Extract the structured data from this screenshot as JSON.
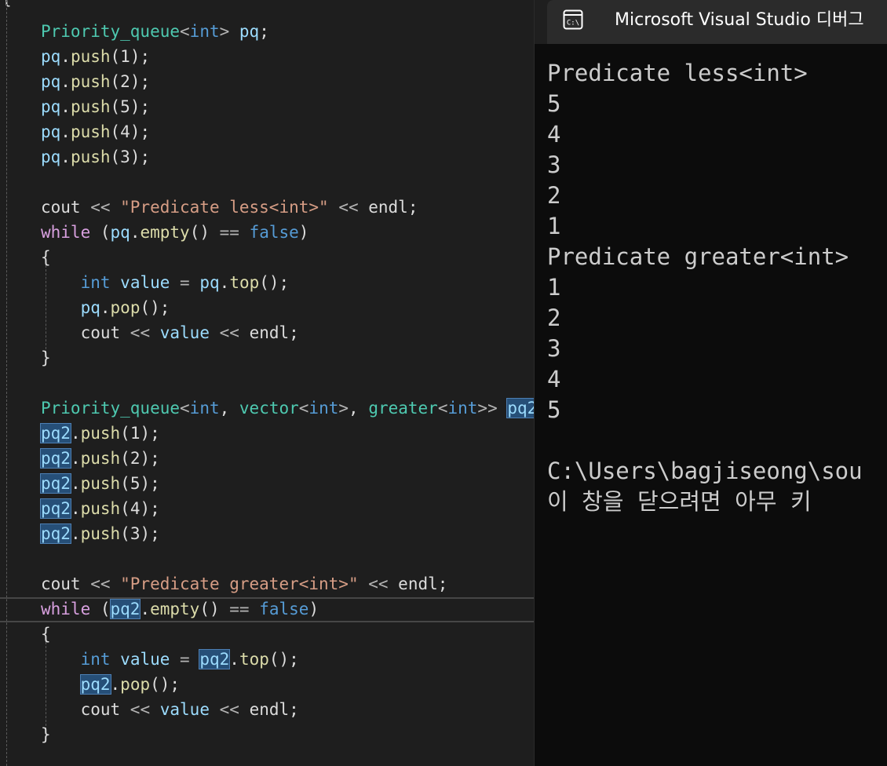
{
  "editor": {
    "lines": [
      {
        "t": [
          {
            "c": "t-class",
            "v": "Priority_queue"
          },
          {
            "c": "t-op",
            "v": "<"
          },
          {
            "c": "t-kw",
            "v": "int"
          },
          {
            "c": "t-op",
            "v": "> "
          },
          {
            "c": "t-var",
            "v": "pq"
          },
          {
            "c": "t-plain",
            "v": ";"
          }
        ]
      },
      {
        "t": [
          {
            "c": "t-var",
            "v": "pq"
          },
          {
            "c": "t-plain",
            "v": "."
          },
          {
            "c": "t-fn",
            "v": "push"
          },
          {
            "c": "t-plain",
            "v": "(1);"
          }
        ]
      },
      {
        "t": [
          {
            "c": "t-var",
            "v": "pq"
          },
          {
            "c": "t-plain",
            "v": "."
          },
          {
            "c": "t-fn",
            "v": "push"
          },
          {
            "c": "t-plain",
            "v": "(2);"
          }
        ]
      },
      {
        "t": [
          {
            "c": "t-var",
            "v": "pq"
          },
          {
            "c": "t-plain",
            "v": "."
          },
          {
            "c": "t-fn",
            "v": "push"
          },
          {
            "c": "t-plain",
            "v": "(5);"
          }
        ]
      },
      {
        "t": [
          {
            "c": "t-var",
            "v": "pq"
          },
          {
            "c": "t-plain",
            "v": "."
          },
          {
            "c": "t-fn",
            "v": "push"
          },
          {
            "c": "t-plain",
            "v": "(4);"
          }
        ]
      },
      {
        "t": [
          {
            "c": "t-var",
            "v": "pq"
          },
          {
            "c": "t-plain",
            "v": "."
          },
          {
            "c": "t-fn",
            "v": "push"
          },
          {
            "c": "t-plain",
            "v": "(3);"
          }
        ]
      },
      {
        "t": []
      },
      {
        "t": [
          {
            "c": "t-plain",
            "v": "cout "
          },
          {
            "c": "t-op",
            "v": "<< "
          },
          {
            "c": "t-str",
            "v": "\"Predicate less<int>\""
          },
          {
            "c": "t-op",
            "v": " << "
          },
          {
            "c": "t-plain",
            "v": "endl;"
          }
        ]
      },
      {
        "t": [
          {
            "c": "t-ctl",
            "v": "while"
          },
          {
            "c": "t-plain",
            "v": " ("
          },
          {
            "c": "t-var",
            "v": "pq"
          },
          {
            "c": "t-plain",
            "v": "."
          },
          {
            "c": "t-fn",
            "v": "empty"
          },
          {
            "c": "t-plain",
            "v": "() "
          },
          {
            "c": "t-op",
            "v": "=="
          },
          {
            "c": "t-plain",
            "v": " "
          },
          {
            "c": "t-kw",
            "v": "false"
          },
          {
            "c": "t-plain",
            "v": ")"
          }
        ]
      },
      {
        "t": [
          {
            "c": "t-plain",
            "v": "{"
          }
        ]
      },
      {
        "t": [
          {
            "c": "t-plain",
            "v": "    "
          },
          {
            "c": "t-kw",
            "v": "int"
          },
          {
            "c": "t-plain",
            "v": " "
          },
          {
            "c": "t-var",
            "v": "value"
          },
          {
            "c": "t-plain",
            "v": " "
          },
          {
            "c": "t-op",
            "v": "="
          },
          {
            "c": "t-plain",
            "v": " "
          },
          {
            "c": "t-var",
            "v": "pq"
          },
          {
            "c": "t-plain",
            "v": "."
          },
          {
            "c": "t-fn",
            "v": "top"
          },
          {
            "c": "t-plain",
            "v": "();"
          }
        ]
      },
      {
        "t": [
          {
            "c": "t-plain",
            "v": "    "
          },
          {
            "c": "t-var",
            "v": "pq"
          },
          {
            "c": "t-plain",
            "v": "."
          },
          {
            "c": "t-fn",
            "v": "pop"
          },
          {
            "c": "t-plain",
            "v": "();"
          }
        ]
      },
      {
        "t": [
          {
            "c": "t-plain",
            "v": "    cout "
          },
          {
            "c": "t-op",
            "v": "<<"
          },
          {
            "c": "t-plain",
            "v": " "
          },
          {
            "c": "t-var",
            "v": "value"
          },
          {
            "c": "t-plain",
            "v": " "
          },
          {
            "c": "t-op",
            "v": "<<"
          },
          {
            "c": "t-plain",
            "v": " endl;"
          }
        ]
      },
      {
        "t": [
          {
            "c": "t-plain",
            "v": "}"
          }
        ]
      },
      {
        "t": []
      },
      {
        "t": [
          {
            "c": "t-class",
            "v": "Priority_queue"
          },
          {
            "c": "t-op",
            "v": "<"
          },
          {
            "c": "t-kw",
            "v": "int"
          },
          {
            "c": "t-plain",
            "v": ", "
          },
          {
            "c": "t-class",
            "v": "vector"
          },
          {
            "c": "t-op",
            "v": "<"
          },
          {
            "c": "t-kw",
            "v": "int"
          },
          {
            "c": "t-op",
            "v": ">"
          },
          {
            "c": "t-plain",
            "v": ", "
          },
          {
            "c": "t-class",
            "v": "greater"
          },
          {
            "c": "t-op",
            "v": "<"
          },
          {
            "c": "t-kw",
            "v": "int"
          },
          {
            "c": "t-op",
            "v": ">>"
          },
          {
            "c": "t-plain",
            "v": " "
          },
          {
            "c": "t-hl",
            "v": "pq2"
          },
          {
            "c": "t-plain",
            "v": ";"
          }
        ]
      },
      {
        "t": [
          {
            "c": "t-hl",
            "v": "pq2"
          },
          {
            "c": "t-plain",
            "v": "."
          },
          {
            "c": "t-fn",
            "v": "push"
          },
          {
            "c": "t-plain",
            "v": "(1);"
          }
        ]
      },
      {
        "t": [
          {
            "c": "t-hl",
            "v": "pq2"
          },
          {
            "c": "t-plain",
            "v": "."
          },
          {
            "c": "t-fn",
            "v": "push"
          },
          {
            "c": "t-plain",
            "v": "(2);"
          }
        ]
      },
      {
        "t": [
          {
            "c": "t-hl",
            "v": "pq2"
          },
          {
            "c": "t-plain",
            "v": "."
          },
          {
            "c": "t-fn",
            "v": "push"
          },
          {
            "c": "t-plain",
            "v": "(5);"
          }
        ]
      },
      {
        "t": [
          {
            "c": "t-hl",
            "v": "pq2"
          },
          {
            "c": "t-plain",
            "v": "."
          },
          {
            "c": "t-fn",
            "v": "push"
          },
          {
            "c": "t-plain",
            "v": "(4);"
          }
        ]
      },
      {
        "t": [
          {
            "c": "t-hl",
            "v": "pq2"
          },
          {
            "c": "t-plain",
            "v": "."
          },
          {
            "c": "t-fn",
            "v": "push"
          },
          {
            "c": "t-plain",
            "v": "(3);"
          }
        ]
      },
      {
        "t": []
      },
      {
        "t": [
          {
            "c": "t-plain",
            "v": "cout "
          },
          {
            "c": "t-op",
            "v": "<< "
          },
          {
            "c": "t-str",
            "v": "\"Predicate greater<int>\""
          },
          {
            "c": "t-op",
            "v": " << "
          },
          {
            "c": "t-plain",
            "v": "endl;"
          }
        ]
      },
      {
        "t": [
          {
            "c": "t-ctl",
            "v": "while"
          },
          {
            "c": "t-plain",
            "v": " ("
          },
          {
            "c": "t-hl",
            "v": "pq2"
          },
          {
            "c": "t-plain",
            "v": "."
          },
          {
            "c": "t-fn",
            "v": "empty"
          },
          {
            "c": "t-plain",
            "v": "() "
          },
          {
            "c": "t-op",
            "v": "=="
          },
          {
            "c": "t-plain",
            "v": " "
          },
          {
            "c": "t-kw",
            "v": "false"
          },
          {
            "c": "t-plain",
            "v": ")"
          }
        ]
      },
      {
        "t": [
          {
            "c": "t-plain",
            "v": "{"
          }
        ]
      },
      {
        "t": [
          {
            "c": "t-plain",
            "v": "    "
          },
          {
            "c": "t-kw",
            "v": "int"
          },
          {
            "c": "t-plain",
            "v": " "
          },
          {
            "c": "t-var",
            "v": "value"
          },
          {
            "c": "t-plain",
            "v": " "
          },
          {
            "c": "t-op",
            "v": "="
          },
          {
            "c": "t-plain",
            "v": " "
          },
          {
            "c": "t-hl",
            "v": "pq2"
          },
          {
            "c": "t-plain",
            "v": "."
          },
          {
            "c": "t-fn",
            "v": "top"
          },
          {
            "c": "t-plain",
            "v": "();"
          }
        ]
      },
      {
        "t": [
          {
            "c": "t-plain",
            "v": "    "
          },
          {
            "c": "t-hl",
            "v": "pq2"
          },
          {
            "c": "t-plain",
            "v": "."
          },
          {
            "c": "t-fn",
            "v": "pop"
          },
          {
            "c": "t-plain",
            "v": "();"
          }
        ]
      },
      {
        "t": [
          {
            "c": "t-plain",
            "v": "    cout "
          },
          {
            "c": "t-op",
            "v": "<<"
          },
          {
            "c": "t-plain",
            "v": " "
          },
          {
            "c": "t-var",
            "v": "value"
          },
          {
            "c": "t-plain",
            "v": " "
          },
          {
            "c": "t-op",
            "v": "<<"
          },
          {
            "c": "t-plain",
            "v": " endl;"
          }
        ]
      },
      {
        "t": [
          {
            "c": "t-plain",
            "v": "}"
          }
        ]
      }
    ],
    "top_brace": "{"
  },
  "console": {
    "window_title": "Microsoft Visual Studio 디버그",
    "close_label": "✕",
    "icon_name": "console-window-icon",
    "output_lines": [
      "Predicate less<int>",
      "5",
      "4",
      "3",
      "2",
      "1",
      "Predicate greater<int>",
      "1",
      "2",
      "3",
      "4",
      "5",
      "",
      "C:\\Users\\bagjiseong\\sou",
      "이 창을 닫으려면 아무 키"
    ]
  }
}
